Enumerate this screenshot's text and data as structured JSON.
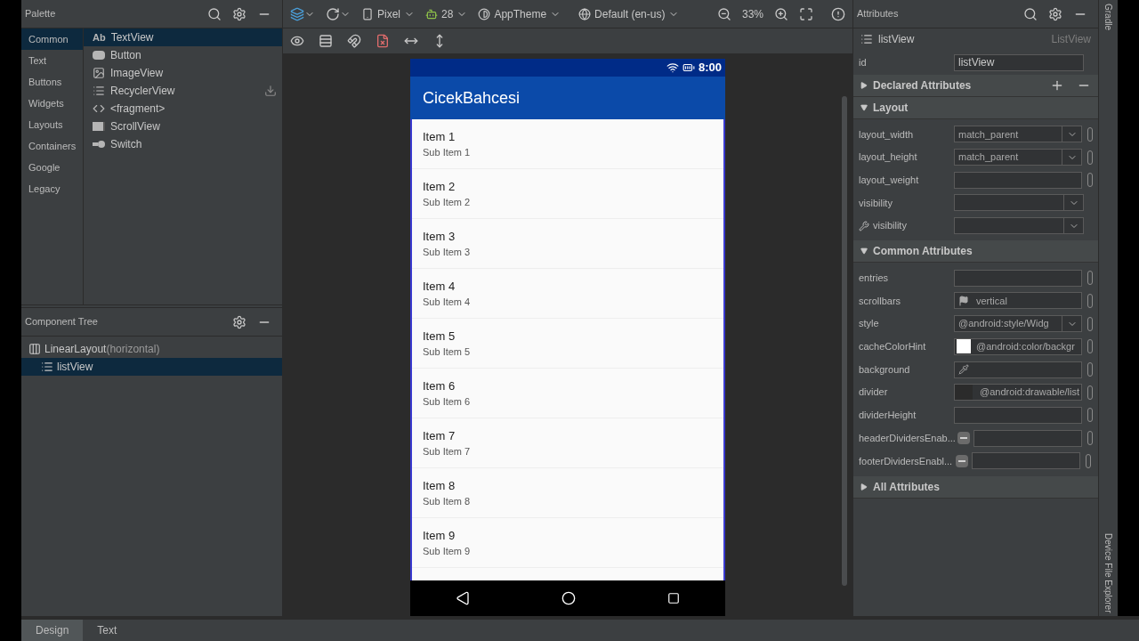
{
  "palette": {
    "title": "Palette",
    "categories": [
      {
        "label": "Common",
        "selected": true
      },
      {
        "label": "Text",
        "selected": false
      },
      {
        "label": "Buttons",
        "selected": false
      },
      {
        "label": "Widgets",
        "selected": false
      },
      {
        "label": "Layouts",
        "selected": false
      },
      {
        "label": "Containers",
        "selected": false
      },
      {
        "label": "Google",
        "selected": false
      },
      {
        "label": "Legacy",
        "selected": false
      }
    ],
    "widgets": [
      {
        "label": "TextView",
        "icon": "Ab",
        "kind": "text",
        "selected": true
      },
      {
        "label": "Button",
        "kind": "button",
        "selected": false
      },
      {
        "label": "ImageView",
        "kind": "image",
        "selected": false
      },
      {
        "label": "RecyclerView",
        "kind": "list",
        "selected": false,
        "download": true
      },
      {
        "label": "<fragment>",
        "kind": "code",
        "selected": false
      },
      {
        "label": "ScrollView",
        "kind": "scroll",
        "selected": false
      },
      {
        "label": "Switch",
        "kind": "switch",
        "selected": false
      }
    ]
  },
  "component_tree": {
    "title": "Component Tree",
    "items": [
      {
        "label": "LinearLayout",
        "detail": "(horizontal)",
        "kind": "columns",
        "selected": false,
        "children": [
          {
            "label": "listView",
            "kind": "list",
            "selected": true
          }
        ]
      }
    ]
  },
  "toolbar": {
    "device": "Pixel",
    "api": "28",
    "theme": "AppTheme",
    "locale": "Default (en-us)",
    "zoom": "33%"
  },
  "phone": {
    "time": "8:00",
    "app_title": "CicekBahcesi",
    "items": [
      {
        "title": "Item 1",
        "subtitle": "Sub Item 1"
      },
      {
        "title": "Item 2",
        "subtitle": "Sub Item 2"
      },
      {
        "title": "Item 3",
        "subtitle": "Sub Item 3"
      },
      {
        "title": "Item 4",
        "subtitle": "Sub Item 4"
      },
      {
        "title": "Item 5",
        "subtitle": "Sub Item 5"
      },
      {
        "title": "Item 6",
        "subtitle": "Sub Item 6"
      },
      {
        "title": "Item 7",
        "subtitle": "Sub Item 7"
      },
      {
        "title": "Item 8",
        "subtitle": "Sub Item 8"
      },
      {
        "title": "Item 9",
        "subtitle": "Sub Item 9"
      }
    ]
  },
  "attributes": {
    "title": "Attributes",
    "component": "listView",
    "component_class": "ListView",
    "id_label": "id",
    "id_value": "listView",
    "sections": [
      {
        "title": "Declared Attributes",
        "expanded": false,
        "add": true
      },
      {
        "title": "Layout",
        "expanded": true,
        "rows": [
          {
            "label": "layout_width",
            "kind": "dropdown",
            "value": "match_parent"
          },
          {
            "label": "layout_height",
            "kind": "dropdown",
            "value": "match_parent"
          },
          {
            "label": "layout_weight",
            "kind": "text"
          },
          {
            "label": "visibility",
            "kind": "dropdown",
            "nobracket": true
          },
          {
            "label": "visibility",
            "kind": "tooldropdown",
            "nobracket": true
          }
        ]
      },
      {
        "title": "Common Attributes",
        "expanded": true,
        "rows": [
          {
            "label": "entries",
            "kind": "text"
          },
          {
            "label": "scrollbars",
            "kind": "flag",
            "value": "vertical"
          },
          {
            "label": "style",
            "kind": "dropdown",
            "value": "@android:style/Widg"
          },
          {
            "label": "cacheColorHint",
            "kind": "color",
            "value": "@android:color/backgr"
          },
          {
            "label": "background",
            "kind": "eyedropper"
          },
          {
            "label": "divider",
            "kind": "drawable",
            "value": "@android:drawable/list"
          },
          {
            "label": "dividerHeight",
            "kind": "text"
          },
          {
            "label": "headerDividersEnab...",
            "kind": "toggle",
            "indeterminate": true
          },
          {
            "label": "footerDividersEnabl...",
            "kind": "toggle",
            "indeterminate": true
          }
        ]
      },
      {
        "title": "All Attributes",
        "expanded": false
      }
    ]
  },
  "side_tools": {
    "top": "Gradle",
    "bottom": "Device File Explorer"
  },
  "bottom_tabs": [
    {
      "label": "Design",
      "selected": true
    },
    {
      "label": "Text",
      "selected": false
    }
  ]
}
